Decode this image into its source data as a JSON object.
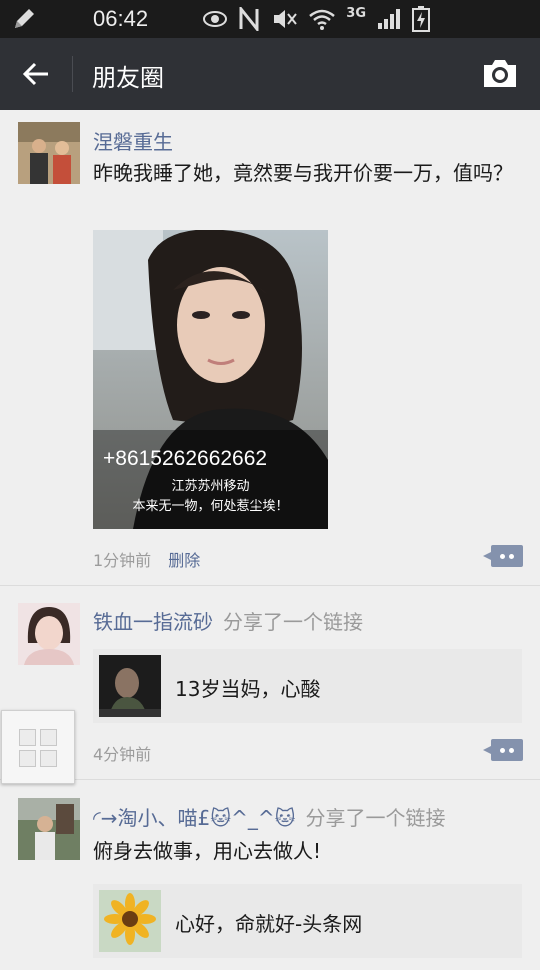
{
  "status_bar": {
    "time": "06:42",
    "network": "3G"
  },
  "header": {
    "title": "朋友圈"
  },
  "posts": [
    {
      "author": "涅磐重生",
      "text": "昨晚我睡了她，竟然要与我开价要一万，值吗？",
      "image": {
        "phone": "+8615262662662",
        "location": "江苏苏州移动",
        "caption": "本来无一物，何处惹尘埃！"
      },
      "time": "1分钟前",
      "delete_label": "删除"
    },
    {
      "author": "铁血一指流砂",
      "action": "分享了一个链接",
      "link_title": "13岁当妈，心酸",
      "time": "4分钟前"
    },
    {
      "author": "◜→淘小、喵£🐱^_^🐱",
      "action": "分享了一个链接",
      "text": "俯身去做事，用心去做人!",
      "link_title": "心好，命就好-头条网"
    }
  ],
  "colors": {
    "name_blue": "#576b95",
    "header_bg": "#2f3136",
    "status_bg": "#1b1b1b"
  }
}
